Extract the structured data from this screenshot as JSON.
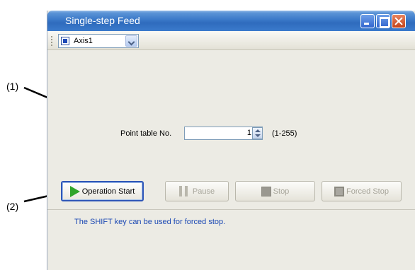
{
  "callouts": {
    "one": "(1)",
    "two": "(2)"
  },
  "window": {
    "title": "Single-step Feed",
    "controls": [
      "minimize",
      "maximize",
      "close"
    ]
  },
  "toolbar": {
    "axis_selected": "Axis1"
  },
  "point_table": {
    "label": "Point table No.",
    "value": "1",
    "range": "(1-255)"
  },
  "buttons": {
    "start": "Operation Start",
    "pause": "Pause",
    "stop": "Stop",
    "forced_stop": "Forced Stop"
  },
  "hint": "The SHIFT key can be used for forced stop.",
  "colors": {
    "titlebar": "#3a78c8",
    "hint_text": "#1d4ab4",
    "play_icon": "#2fa52a"
  }
}
